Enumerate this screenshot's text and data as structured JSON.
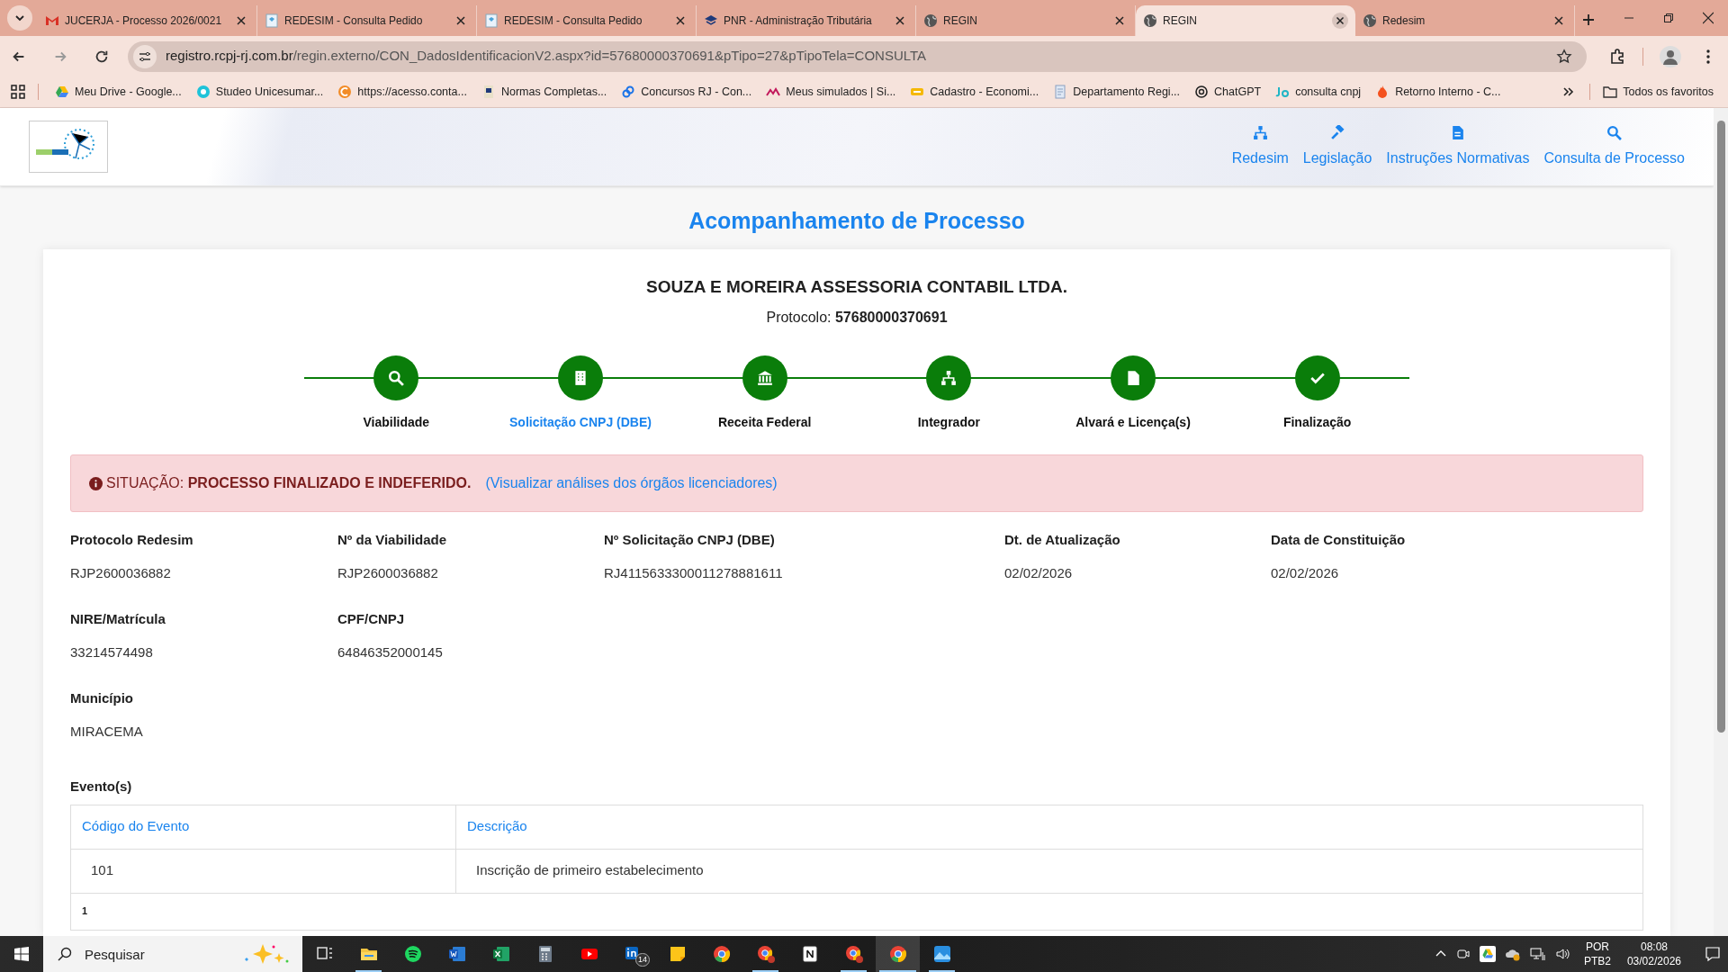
{
  "browser": {
    "tabs": [
      {
        "title": "JUCERJA - Processo 2026/0021",
        "selected": false
      },
      {
        "title": "REDESIM - Consulta Pedido",
        "selected": false
      },
      {
        "title": "REDESIM - Consulta Pedido",
        "selected": false
      },
      {
        "title": "PNR - Administração Tributária",
        "selected": false
      },
      {
        "title": "REGIN",
        "selected": false
      },
      {
        "title": "REGIN",
        "selected": true
      },
      {
        "title": "Redesim",
        "selected": false
      }
    ],
    "url_host": "registro.rcpj-rj.com.br",
    "url_path": "/regin.externo/CON_DadosIdentificacionV2.aspx?id=57680000370691&pTipo=27&pTipoTela=CONSULTA",
    "bookmarks": [
      "Meu Drive - Google...",
      "Studeo Unicesumar...",
      "https://acesso.conta...",
      "Normas Completas...",
      "Concursos RJ - Con...",
      "Meus simulados | Si...",
      "Cadastro - Economi...",
      "Departamento Regi...",
      "ChatGPT",
      "consulta cnpj",
      "Retorno Interno - C..."
    ],
    "all_bookmarks": "Todos os favoritos"
  },
  "header": {
    "nav": [
      "Redesim",
      "Legislação",
      "Instruções Normativas",
      "Consulta de Processo"
    ]
  },
  "title": "Acompanhamento de Processo",
  "company": "SOUZA E MOREIRA ASSESSORIA CONTABIL LTDA.",
  "protocol": "Protocolo: **57680000370691**",
  "steps": [
    {
      "label": "Viabilidade",
      "selected": false
    },
    {
      "label": "Solicitação CNPJ (DBE)",
      "selected": true
    },
    {
      "label": "Receita Federal",
      "selected": false
    },
    {
      "label": "Integrador",
      "selected": false
    },
    {
      "label": "Alvará e Licença(s)",
      "selected": false
    },
    {
      "label": "Finalização",
      "selected": false
    }
  ],
  "status": {
    "text": "SITUAÇÃO: **PROCESSO FINALIZADO E INDEFERIDO.**",
    "link": "(Visualizar análises dos órgãos licenciadores)"
  },
  "fields": [
    [
      {
        "label": "Protocolo Redesim",
        "value": "RJP2600036882"
      },
      {
        "label": "Nº da Viabilidade",
        "value": "RJP2600036882"
      },
      {
        "label": "Nº Solicitação CNPJ (DBE)",
        "value": "RJ4115633300011278881611"
      },
      {
        "label": "Dt. de Atualização",
        "value": "02/02/2026"
      },
      {
        "label": "Data de Constituição",
        "value": "02/02/2026"
      }
    ],
    [
      {
        "label": "NIRE/Matrícula",
        "value": "33214574498"
      },
      {
        "label": "CPF/CNPJ",
        "value": "64846352000145"
      }
    ],
    [
      {
        "label": "Município",
        "value": "MIRACEMA"
      }
    ]
  ],
  "events": {
    "label": "Evento(s)",
    "columns": [
      "Código do Evento",
      "Descrição"
    ],
    "rows": [
      [
        "101",
        "Inscrição de primeiro estabelecimento"
      ]
    ],
    "page": "1"
  },
  "taskbar": {
    "search_placeholder": "Pesquisar",
    "apps": [
      {
        "running": false,
        "selected": false
      },
      {
        "running": true,
        "selected": false
      },
      {
        "running": false,
        "selected": false
      },
      {
        "running": false,
        "selected": false
      },
      {
        "running": false,
        "selected": false
      },
      {
        "running": false,
        "selected": false
      },
      {
        "running": false,
        "selected": false
      },
      {
        "running": false,
        "selected": false,
        "badge": "14"
      },
      {
        "running": false,
        "selected": false
      },
      {
        "running": false,
        "selected": false
      },
      {
        "running": true,
        "selected": false
      },
      {
        "running": false,
        "selected": false
      },
      {
        "running": true,
        "selected": false
      },
      {
        "running": true,
        "selected": true
      },
      {
        "running": true,
        "selected": false
      }
    ],
    "lang": "POR",
    "layout": "PTB2",
    "time": "08:08",
    "date": "03/02/2026"
  }
}
